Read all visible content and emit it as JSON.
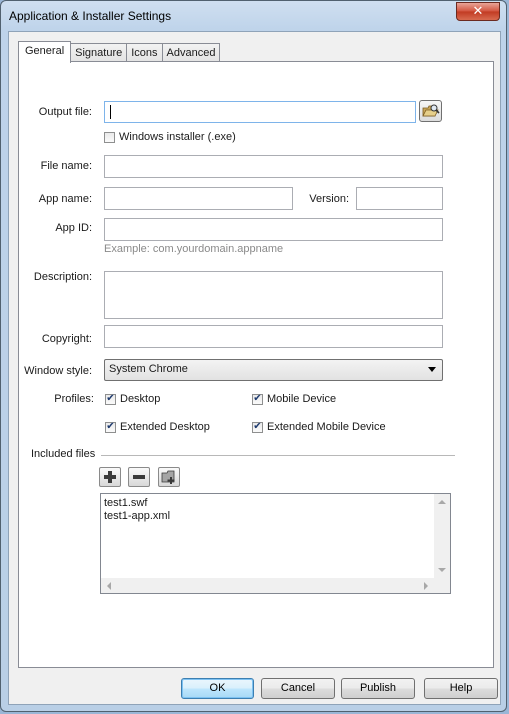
{
  "window": {
    "title": "Application & Installer Settings",
    "close_glyph": "✕"
  },
  "tabs": [
    {
      "label": "General",
      "active": true
    },
    {
      "label": "Signature",
      "active": false
    },
    {
      "label": "Icons",
      "active": false
    },
    {
      "label": "Advanced",
      "active": false
    }
  ],
  "general": {
    "output_file": {
      "label": "Output file:",
      "value": ""
    },
    "windows_installer": {
      "label": "Windows installer (.exe)",
      "checked": false
    },
    "file_name": {
      "label": "File name:",
      "value": ""
    },
    "app_name": {
      "label": "App name:",
      "value": ""
    },
    "version": {
      "label": "Version:",
      "value": ""
    },
    "app_id": {
      "label": "App ID:",
      "value": "",
      "hint": "Example: com.yourdomain.appname"
    },
    "description": {
      "label": "Description:",
      "value": ""
    },
    "copyright": {
      "label": "Copyright:",
      "value": ""
    },
    "window_style": {
      "label": "Window style:",
      "selected": "System Chrome"
    },
    "profiles": {
      "label": "Profiles:",
      "desktop": {
        "label": "Desktop",
        "checked": true
      },
      "mobile_device": {
        "label": "Mobile Device",
        "checked": true
      },
      "extended_desktop": {
        "label": "Extended Desktop",
        "checked": true
      },
      "extended_mobile_device": {
        "label": "Extended Mobile Device",
        "checked": true
      }
    },
    "included_files": {
      "label": "Included files",
      "items": [
        "test1.swf",
        "test1-app.xml"
      ]
    }
  },
  "buttons": {
    "ok": "OK",
    "cancel": "Cancel",
    "publish": "Publish",
    "help": "Help"
  },
  "colors": {
    "title_bg": "#bed3ea",
    "close_red": "#c13a22",
    "default_button_border": "#3c7fb1"
  },
  "icons": {
    "browse": "folder-browse-icon",
    "add": "plus-icon",
    "remove": "minus-icon",
    "add_folder": "add-folder-icon"
  }
}
